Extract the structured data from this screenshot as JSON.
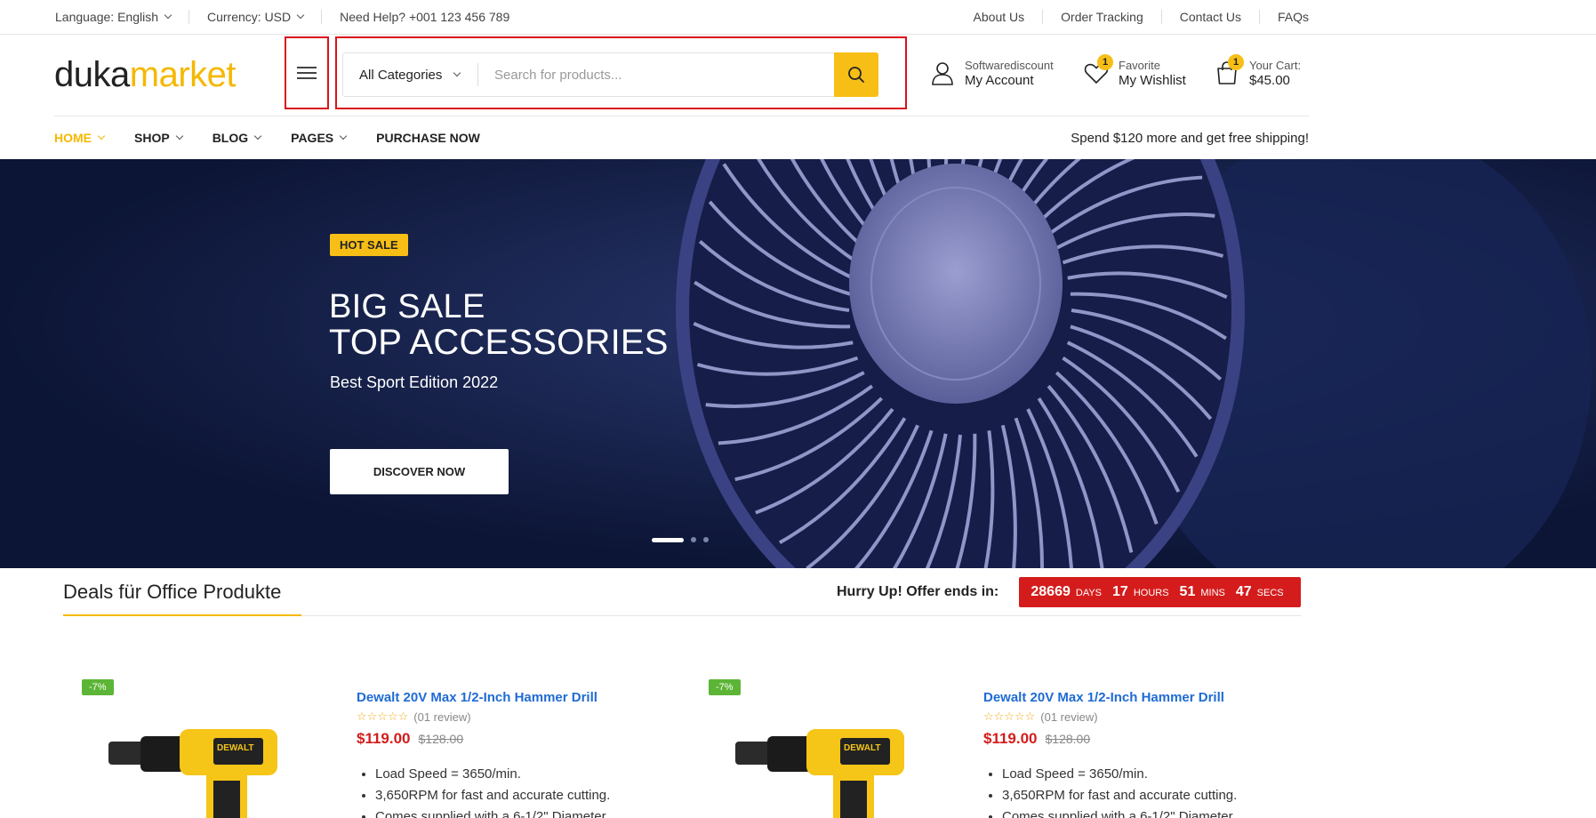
{
  "topbar": {
    "language": "Language: English",
    "currency": "Currency: USD",
    "help": "Need Help? +001 123 456 789",
    "links": [
      "About Us",
      "Order Tracking",
      "Contact Us",
      "FAQs"
    ]
  },
  "header": {
    "logo_part1": "duka",
    "logo_part2": "market",
    "category": "All Categories",
    "search_placeholder": "Search for products...",
    "account": {
      "small": "Softwarediscount",
      "big": "My Account"
    },
    "wishlist": {
      "small": "Favorite",
      "big": "My Wishlist",
      "count": "1"
    },
    "cart": {
      "small": "Your Cart:",
      "big": "$45.00",
      "count": "1"
    }
  },
  "nav": {
    "items": [
      "HOME",
      "SHOP",
      "BLOG",
      "PAGES",
      "PURCHASE NOW"
    ],
    "shipping": "Spend $120 more and get free shipping!"
  },
  "hero": {
    "tag": "HOT SALE",
    "line1": "BIG SALE",
    "line2": "TOP ACCESSORIES",
    "line3": "Best Sport Edition 2022",
    "cta": "DISCOVER NOW"
  },
  "deals": {
    "title": "Deals für Office Produkte",
    "hurry": "Hurry Up! Offer ends in:",
    "timer": {
      "days": "28669",
      "days_label": "DAYS",
      "hours": "17",
      "hours_label": "HOURS",
      "mins": "51",
      "mins_label": "MINS",
      "secs": "47",
      "secs_label": "SECS"
    },
    "products": [
      {
        "discount": "-7%",
        "name": "Dewalt 20V Max 1/2-Inch Hammer Drill",
        "stars": "☆☆☆☆☆",
        "reviews": "(01 review)",
        "price": "$119.00",
        "old_price": "$128.00",
        "features": [
          "Load Speed = 3650/min.",
          "3,650RPM for fast and accurate cutting.",
          "Comes supplied with a 6-1/2\" Diameter"
        ]
      },
      {
        "discount": "-7%",
        "name": "Dewalt 20V Max 1/2-Inch Hammer Drill",
        "stars": "☆☆☆☆☆",
        "reviews": "(01 review)",
        "price": "$119.00",
        "old_price": "$128.00",
        "features": [
          "Load Speed = 3650/min.",
          "3,650RPM for fast and accurate cutting.",
          "Comes supplied with a 6-1/2\" Diameter"
        ]
      }
    ]
  },
  "colors": {
    "accent": "#f7be16",
    "highlight": "#d9131b",
    "link": "#1f6bd3",
    "sale": "#d41c1c",
    "discount": "#5cb536",
    "hero_bg": "#0e1a3c"
  }
}
